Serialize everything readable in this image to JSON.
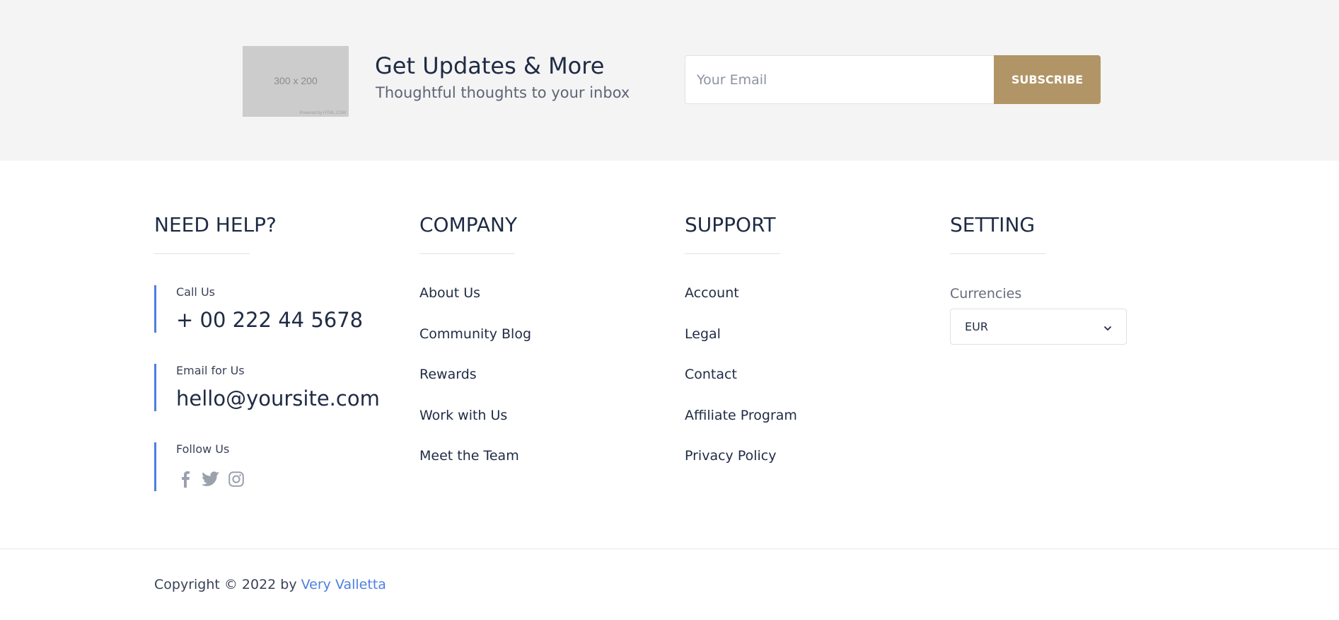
{
  "newsletter": {
    "image_placeholder": {
      "dims": "300 x 200",
      "powered": "Powered by HTML.COM"
    },
    "title": "Get Updates & More",
    "subtitle": "Thoughtful thoughts to your inbox",
    "email_placeholder": "Your Email",
    "subscribe_label": "SUBSCRIBE",
    "accent_color": "#b29566"
  },
  "need_help": {
    "title": "NEED HELP?",
    "call_label": "Call Us",
    "call_value": "+ 00 222 44 5678",
    "email_label": "Email for Us",
    "email_value": "hello@yoursite.com",
    "follow_label": "Follow Us",
    "social_icons": [
      "facebook-icon",
      "twitter-icon",
      "instagram-icon"
    ]
  },
  "company": {
    "title": "COMPANY",
    "links": [
      "About Us",
      "Community Blog",
      "Rewards",
      "Work with Us",
      "Meet the Team"
    ]
  },
  "support": {
    "title": "SUPPORT",
    "links": [
      "Account",
      "Legal",
      "Contact",
      "Affiliate Program",
      "Privacy Policy"
    ]
  },
  "setting": {
    "title": "SETTING",
    "currency_label": "Currencies",
    "currency_value": "EUR"
  },
  "footer": {
    "copyright_prefix": "Copyright © 2022 by ",
    "brand": "Very Valletta",
    "brand_color": "#4d7fe0"
  }
}
